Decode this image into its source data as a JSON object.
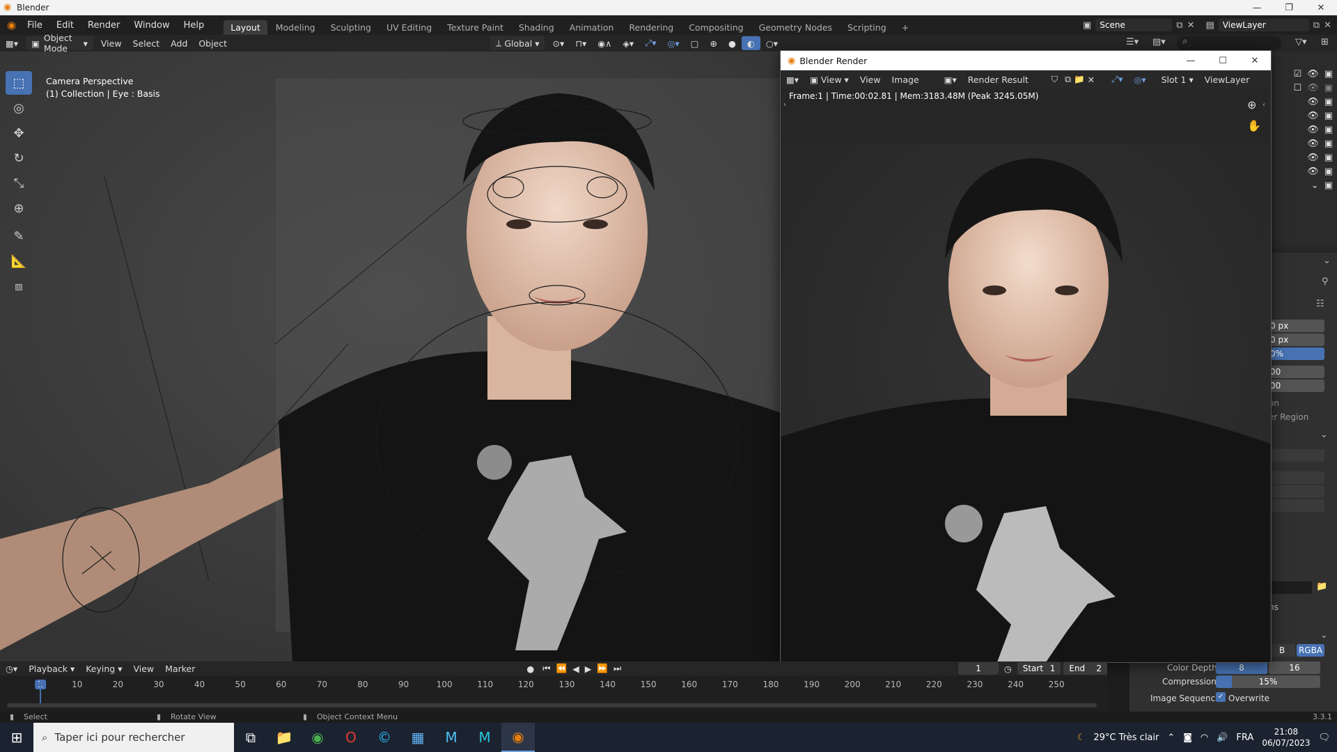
{
  "window": {
    "title": "Blender"
  },
  "menubar": {
    "menus": [
      "File",
      "Edit",
      "Render",
      "Window",
      "Help"
    ],
    "workspaces": [
      "Layout",
      "Modeling",
      "Sculpting",
      "UV Editing",
      "Texture Paint",
      "Shading",
      "Animation",
      "Rendering",
      "Compositing",
      "Geometry Nodes",
      "Scripting"
    ],
    "active_workspace": "Layout",
    "scene": "Scene",
    "view_layer": "ViewLayer"
  },
  "viewport_header": {
    "mode": "Object Mode",
    "menus": [
      "View",
      "Select",
      "Add",
      "Object"
    ],
    "orientation": "Global"
  },
  "viewport": {
    "camera_label": "Camera Perspective",
    "collection_label": "(1) Collection | Eye : Basis"
  },
  "render_window": {
    "title": "Blender Render",
    "menus": [
      "View",
      "View",
      "Image"
    ],
    "image_name": "Render Result",
    "slot": "Slot 1",
    "view_layer": "ViewLayer",
    "info": "Frame:1 | Time:00:02.81 | Mem:3183.48M (Peak 3245.05M)"
  },
  "properties": {
    "partial_fields": [
      "0 px",
      "0 px",
      "0%",
      "00",
      "00"
    ],
    "partial_labels": [
      "on",
      "er Region",
      "ns"
    ],
    "color_mode_partial": "B",
    "color_mode": "RGBA",
    "color_depth_label": "Color Depth",
    "color_depth_values": [
      "8",
      "16"
    ],
    "compression_label": "Compression",
    "compression_value": "15%",
    "compression_fraction": 0.15,
    "image_sequence_label": "Image Sequence",
    "overwrite_label": "Overwrite"
  },
  "timeline": {
    "menus": [
      "Playback",
      "Keying",
      "View",
      "Marker"
    ],
    "current_frame": "1",
    "start_label": "Start",
    "start": "1",
    "end_label": "End",
    "end": "2",
    "ticks": [
      "1",
      "10",
      "20",
      "30",
      "40",
      "50",
      "60",
      "70",
      "80",
      "90",
      "100",
      "110",
      "120",
      "130",
      "140",
      "150",
      "160",
      "170",
      "180",
      "190",
      "200",
      "210",
      "220",
      "230",
      "240",
      "250"
    ]
  },
  "statusbar": {
    "select": "Select",
    "rotate": "Rotate View",
    "context": "Object Context Menu",
    "version": "3.3.1"
  },
  "taskbar": {
    "search_placeholder": "Taper ici pour rechercher",
    "weather": "29°C Très clair",
    "lang": "FRA",
    "time": "21:08",
    "date": "06/07/2023"
  },
  "colors": {
    "accent": "#4772b3",
    "blender_orange": "#e87d0d"
  }
}
